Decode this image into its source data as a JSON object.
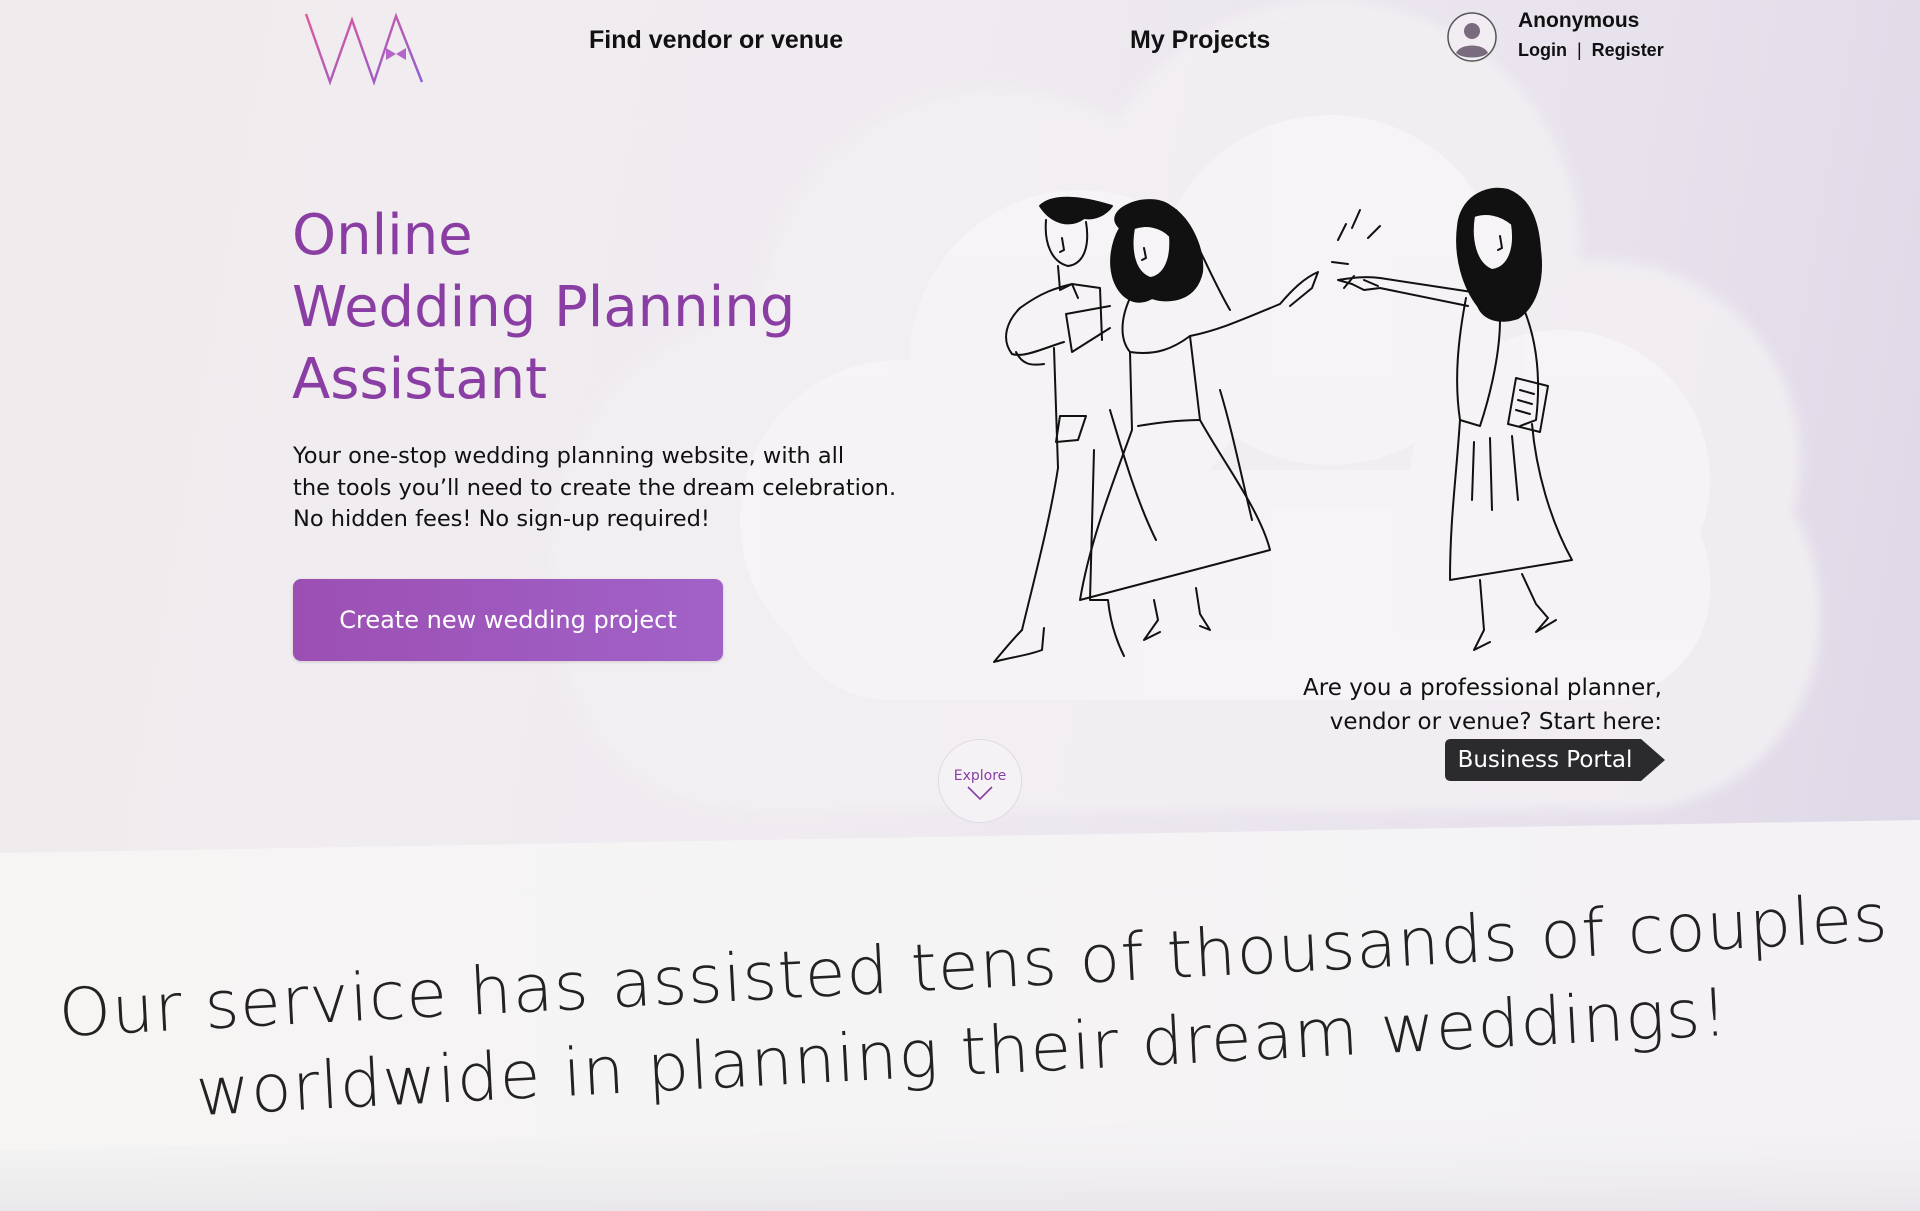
{
  "brand": {
    "logo_text": "WA",
    "accent": "#8a3ea3",
    "logo_gradient": [
      "#e0579a",
      "#8e5fd0"
    ]
  },
  "nav": {
    "find_vendor": "Find vendor or venue",
    "my_projects": "My Projects"
  },
  "user": {
    "name": "Anonymous",
    "login": "Login",
    "separator": "|",
    "register": "Register",
    "avatar_icon": "user-avatar-icon"
  },
  "hero": {
    "title_lines": [
      "Online",
      "Wedding Planning",
      "Assistant"
    ],
    "description_lines": [
      "Your one-stop wedding planning website, with all",
      "the tools you’ll need to create the dream celebration.",
      "No hidden fees! No sign-up required!"
    ],
    "cta_label": "Create new wedding project",
    "cta_gradient": [
      "#9c4fb3",
      "#a162c8"
    ]
  },
  "pro": {
    "lines": [
      "Are you a professional planner,",
      "vendor or venue? Start here:"
    ],
    "button_label": "Business Portal",
    "button_color": "#2b2b2e"
  },
  "explore": {
    "label": "Explore",
    "icon": "chevron-down-icon"
  },
  "tagline": {
    "lines": [
      "Our service has assisted tens of thousands of couples",
      "worldwide in planning their dream weddings!"
    ]
  }
}
